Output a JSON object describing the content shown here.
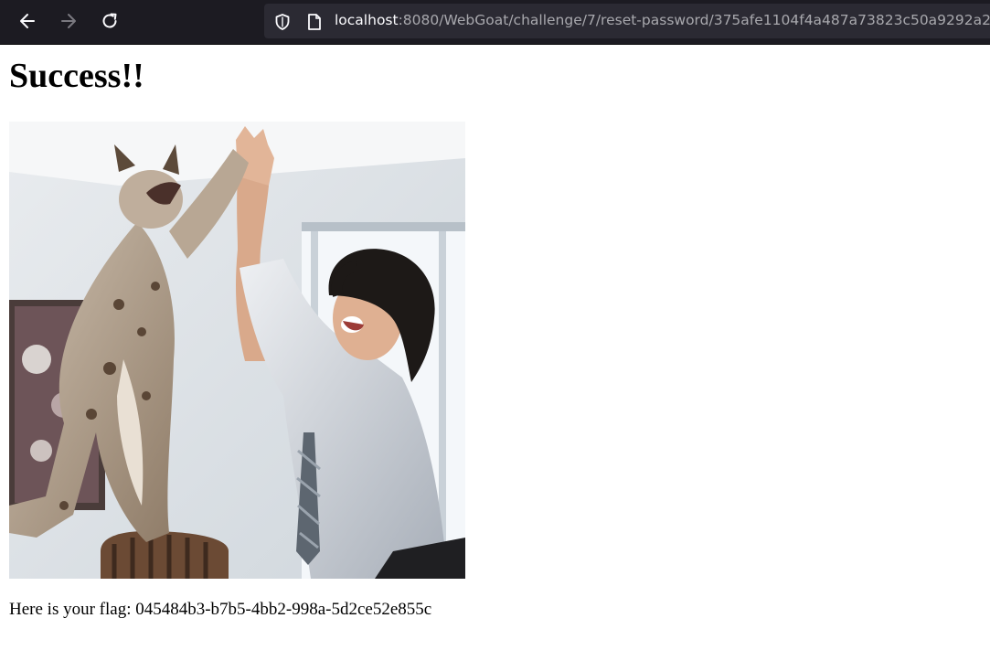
{
  "browser": {
    "url_host": "localhost",
    "url_rest": ":8080/WebGoat/challenge/7/reset-password/375afe1104f4a487a73823c50a9292a2",
    "icons": {
      "back": "arrow-left-icon",
      "forward": "arrow-right-icon",
      "reload": "reload-icon",
      "tracking": "shield-icon",
      "page": "page-icon"
    },
    "colors": {
      "toolbar": "#1c1b22",
      "urlbar": "#2b2a33"
    }
  },
  "page": {
    "heading": "Success!!",
    "image_alt": "A lynx giving a high-five to a smiling man",
    "flag_label": "Here is your flag: 045484b3-b7b5-4bb2-998a-5d2ce52e855c"
  }
}
